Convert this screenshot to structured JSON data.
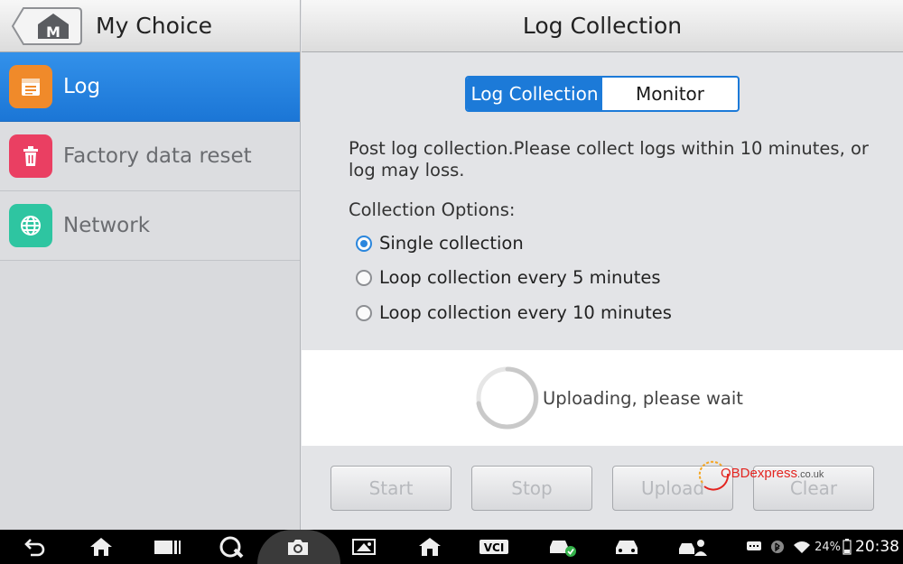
{
  "left": {
    "title": "My Choice",
    "home_icon": "home-m-icon",
    "items": [
      {
        "label": "Log",
        "icon": "log-icon",
        "color": "#f08a2a",
        "active": true
      },
      {
        "label": "Factory data reset",
        "icon": "trash-icon",
        "color": "#ea3f62",
        "active": false
      },
      {
        "label": "Network",
        "icon": "globe-icon",
        "color": "#2ec5a1",
        "active": false
      }
    ]
  },
  "right": {
    "title": "Log Collection",
    "tabs": [
      {
        "label": "Log Collection",
        "active": true
      },
      {
        "label": "Monitor",
        "active": false
      }
    ],
    "notice": "Post log collection.Please collect logs within 10 minutes, or log may loss.",
    "options_title": "Collection Options:",
    "options": [
      {
        "label": "Single collection",
        "checked": true
      },
      {
        "label": "Loop collection every 5 minutes",
        "checked": false
      },
      {
        "label": "Loop collection every 10 minutes",
        "checked": false
      }
    ],
    "progress_text": "Uploading, please wait",
    "buttons": [
      {
        "label": "Start",
        "enabled": false
      },
      {
        "label": "Stop",
        "enabled": false
      },
      {
        "label": "Upload",
        "enabled": false
      },
      {
        "label": "Clear",
        "enabled": false
      }
    ],
    "watermark": {
      "text": "OBDexpress",
      "suffix": ".co.uk"
    }
  },
  "status_bar": {
    "nav_icons": [
      "back-icon",
      "home-icon",
      "recents-icon",
      "browser-icon",
      "camera-icon",
      "display-brightness-icon",
      "shop-icon",
      "vci-icon",
      "vehicle-check-icon",
      "car-icon",
      "remote-expert-icon"
    ],
    "vci_label": "VCI",
    "battery": "24%",
    "time": "20:38"
  },
  "colors": {
    "accent": "#1c7ad8",
    "active_menu": "#2586e1"
  }
}
